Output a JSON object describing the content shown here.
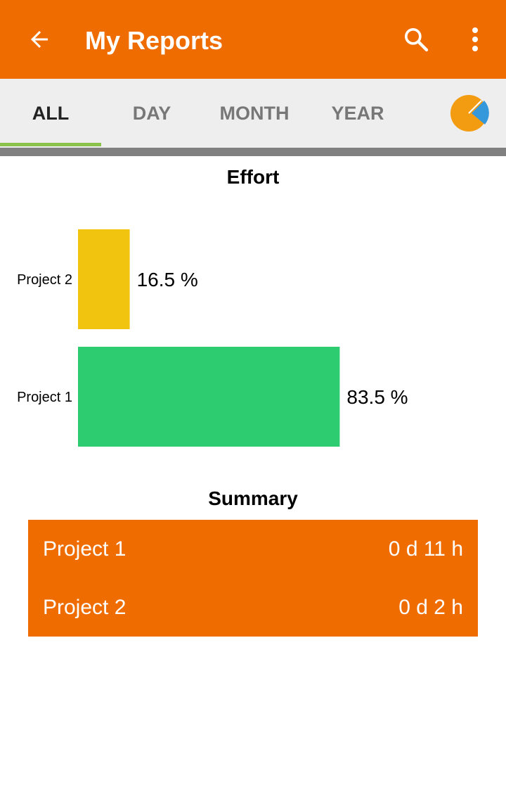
{
  "app_bar": {
    "title": "My Reports",
    "color": "#ef6c00",
    "icons": [
      "back-arrow-icon",
      "search-icon",
      "more-vert-icon"
    ]
  },
  "tabs": [
    {
      "label": "ALL",
      "active": true
    },
    {
      "label": "DAY",
      "active": false
    },
    {
      "label": "MONTH",
      "active": false
    },
    {
      "label": "YEAR",
      "active": false
    }
  ],
  "tab_chart_icon": "pie-chart-icon",
  "tab_indicator_color": "#8bc34a",
  "chart_data": {
    "type": "bar",
    "orientation": "horizontal",
    "title": "Effort",
    "categories": [
      "Project 2",
      "Project 1"
    ],
    "values": [
      16.5,
      83.5
    ],
    "value_labels": [
      "16.5 %",
      "83.5 %"
    ],
    "colors": [
      "#f1c40f",
      "#2ecc71"
    ],
    "unit": "%",
    "xlim": [
      0,
      100
    ],
    "grid": false,
    "legend": "none"
  },
  "summary": {
    "title": "Summary",
    "rows": [
      {
        "project": "Project 1",
        "duration": "0 d 11 h"
      },
      {
        "project": "Project 2",
        "duration": "0 d 2 h"
      }
    ]
  }
}
